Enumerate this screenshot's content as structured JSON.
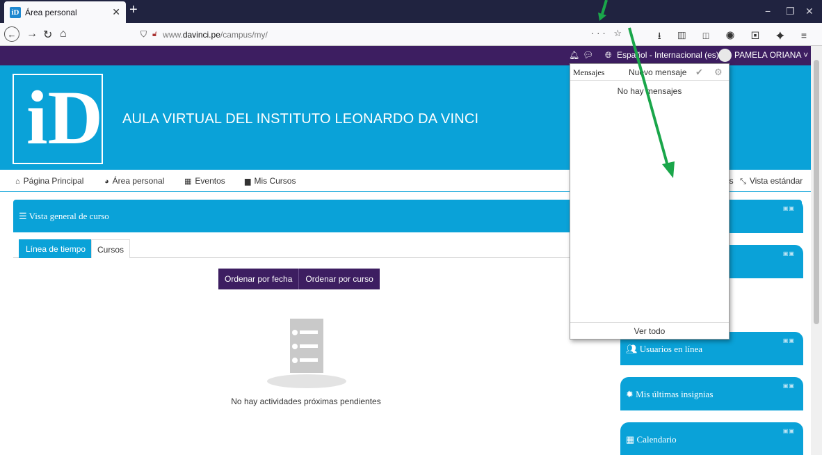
{
  "browser": {
    "tab_title": "Área personal",
    "tab_favicon": "iD",
    "url_prefix": "www.",
    "url_domain": "davinci.pe",
    "url_path": "/campus/my/"
  },
  "topbar": {
    "language": "Español - Internacional (es)",
    "user_name": "PAMELA ORIANA"
  },
  "header": {
    "site_title": "AULA VIRTUAL DEL INSTITUTO LEONARDO DA VINCI"
  },
  "menu": {
    "items": [
      {
        "icon": "home-icon",
        "label": "Página Principal"
      },
      {
        "icon": "dashboard-icon",
        "label": "Área personal"
      },
      {
        "icon": "calendar-icon",
        "label": "Eventos"
      },
      {
        "icon": "briefcase-icon",
        "label": "Mis Cursos"
      }
    ],
    "right_fragment": "es",
    "standard_view": "Vista estándar"
  },
  "course_overview": {
    "title": "Vista general de curso",
    "tabs": [
      "Línea de tiempo",
      "Cursos"
    ],
    "sort_buttons": [
      "Ordenar por fecha",
      "Ordenar por curso"
    ],
    "empty_message": "No hay actividades próximas pendientes"
  },
  "blocks": [
    {
      "title": ""
    },
    {
      "title": ""
    },
    {
      "title": "Usuarios en línea",
      "icon": "users-icon"
    },
    {
      "title": "Mis últimas insignias",
      "icon": "badge-icon"
    },
    {
      "title": "Calendario",
      "icon": "calendar-icon"
    }
  ],
  "messages_popover": {
    "title": "Mensajes",
    "new_message": "Nuevo mensaje",
    "empty": "No hay mensajes",
    "see_all": "Ver todo"
  },
  "colors": {
    "primary": "#0aa2d8",
    "topbar": "#3d1e61",
    "annotation_arrow": "#1aa64a"
  }
}
